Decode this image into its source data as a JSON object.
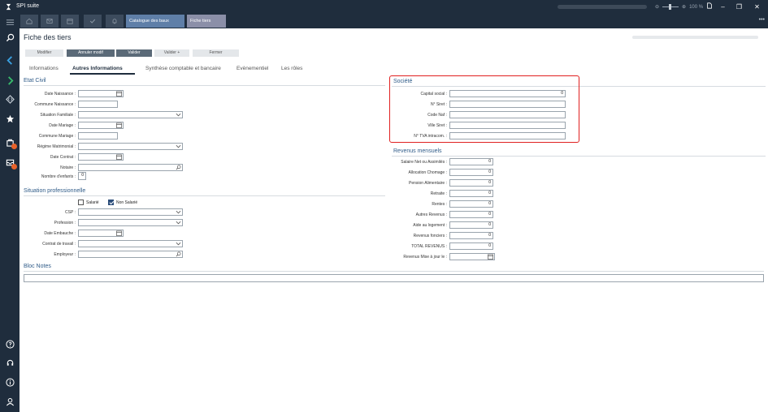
{
  "app": {
    "title": "SPI suite"
  },
  "titlebar": {
    "zoom_label": "100 %"
  },
  "tabs": {
    "quick_buttons": [
      "home-icon",
      "mail-icon",
      "calendar-icon",
      "check-icon",
      "bell-icon"
    ],
    "documents": [
      {
        "label": "Catalogue des baux",
        "active": false
      },
      {
        "label": "Fiche tiers",
        "active": true
      }
    ]
  },
  "page": {
    "title": "Fiche des tiers",
    "actions": [
      {
        "label": "Modifier",
        "style": "light"
      },
      {
        "label": "Annuler modif",
        "style": "dark"
      },
      {
        "label": "Valider",
        "style": "dark"
      },
      {
        "label": "Valider +",
        "style": "light"
      },
      {
        "label": "Fermer",
        "style": "light"
      }
    ],
    "sub_tabs": [
      {
        "label": "Informations",
        "active": false
      },
      {
        "label": "Autres Informations",
        "active": true
      },
      {
        "label": "Synthèse comptable et bancaire",
        "active": false
      },
      {
        "label": "Evènementiel",
        "active": false
      },
      {
        "label": "Les rôles",
        "active": false
      }
    ]
  },
  "etat_civil": {
    "title": "Etat Civil",
    "labels": {
      "date_naissance": "Date Naissance :",
      "commune_naissance": "Commune Naissance :",
      "situation_familiale": "Situation Familiale :",
      "date_mariage": "Date Mariage :",
      "commune_mariage": "Commune Mariage :",
      "regime_matrimonial": "Régime Matrimonial :",
      "date_contrat": "Date Contrat :",
      "notaire": "Notaire :",
      "nombre_enfants": "Nombre d'enfants :"
    },
    "values": {
      "nombre_enfants": "0"
    }
  },
  "situation_pro": {
    "title": "Situation professionnelle",
    "salarie_label": "Salarié",
    "non_salarie_label": "Non Salarié",
    "labels": {
      "csp": "CSP :",
      "profession": "Profession :",
      "date_embauche": "Date Embauche :",
      "contrat_travail": "Contrat de travail :",
      "employeur": "Employeur :"
    }
  },
  "societe": {
    "title": "Société",
    "labels": {
      "capital_social": "Capital social :",
      "siret": "N° Siret :",
      "code_naf": "Code Naf :",
      "ville_siret": "Ville Siret :",
      "tva": "N° TVA intracom. :"
    },
    "values": {
      "capital_social": "0"
    }
  },
  "revenus": {
    "title": "Revenus mensuels",
    "rows": [
      {
        "label": "Salaire Net ou Assimilés :",
        "value": "0"
      },
      {
        "label": "Allocation Chomage :",
        "value": "0"
      },
      {
        "label": "Pension Alimentaire :",
        "value": "0"
      },
      {
        "label": "Retraite :",
        "value": "0"
      },
      {
        "label": "Rentes :",
        "value": "0"
      },
      {
        "label": "Autres Revenus :",
        "value": "0"
      },
      {
        "label": "Aide au logement :",
        "value": "0"
      },
      {
        "label": "Revenus fonciers :",
        "value": "0"
      },
      {
        "label": "TOTAL REVENUS :",
        "value": "0"
      }
    ],
    "mise_a_jour_label": "Revenus Mise à jour le :"
  },
  "bloc_notes": {
    "title": "Bloc Notes"
  },
  "colors": {
    "chrome": "#1f2d3d",
    "accent": "#2f5b88",
    "highlight": "#e02020",
    "badge": "#e8622a"
  }
}
